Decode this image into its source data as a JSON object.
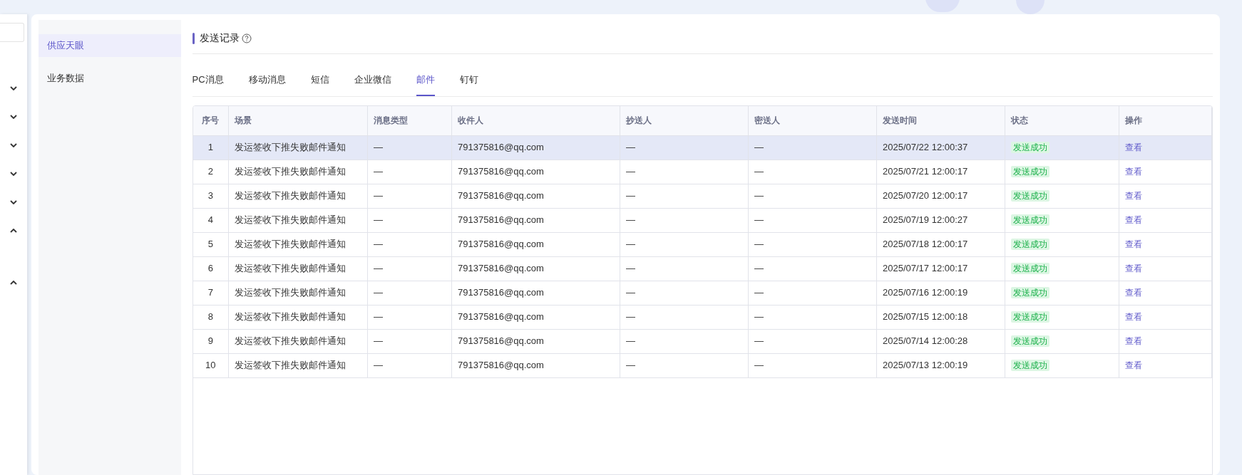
{
  "side_rail": {
    "chevrons": [
      {
        "expanded": false
      },
      {
        "expanded": false
      },
      {
        "expanded": false
      },
      {
        "expanded": false
      },
      {
        "expanded": false
      },
      {
        "expanded": true
      },
      {
        "expanded": true
      }
    ]
  },
  "sub_nav": {
    "items": [
      {
        "label": "供应天眼",
        "selected": true
      },
      {
        "label": "业务数据",
        "selected": false
      }
    ]
  },
  "section_title": "发送记录",
  "tabs": [
    {
      "label": "PC消息",
      "selected": false
    },
    {
      "label": "移动消息",
      "selected": false
    },
    {
      "label": "短信",
      "selected": false
    },
    {
      "label": "企业微信",
      "selected": false
    },
    {
      "label": "邮件",
      "selected": true
    },
    {
      "label": "钉钉",
      "selected": false
    }
  ],
  "table": {
    "columns": [
      "序号",
      "场景",
      "消息类型",
      "收件人",
      "抄送人",
      "密送人",
      "发送时间",
      "状态",
      "操作"
    ],
    "rows": [
      {
        "selected": true,
        "cells": [
          "1",
          "发运签收下推失败邮件通知",
          "—",
          "791375816@qq.com",
          "—",
          "—",
          "2025/07/22 12:00:37",
          "发送成功",
          "查看"
        ]
      },
      {
        "selected": false,
        "cells": [
          "2",
          "发运签收下推失败邮件通知",
          "—",
          "791375816@qq.com",
          "—",
          "—",
          "2025/07/21 12:00:17",
          "发送成功",
          "查看"
        ]
      },
      {
        "selected": false,
        "cells": [
          "3",
          "发运签收下推失败邮件通知",
          "—",
          "791375816@qq.com",
          "—",
          "—",
          "2025/07/20 12:00:17",
          "发送成功",
          "查看"
        ]
      },
      {
        "selected": false,
        "cells": [
          "4",
          "发运签收下推失败邮件通知",
          "—",
          "791375816@qq.com",
          "—",
          "—",
          "2025/07/19 12:00:27",
          "发送成功",
          "查看"
        ]
      },
      {
        "selected": false,
        "cells": [
          "5",
          "发运签收下推失败邮件通知",
          "—",
          "791375816@qq.com",
          "—",
          "—",
          "2025/07/18 12:00:17",
          "发送成功",
          "查看"
        ]
      },
      {
        "selected": false,
        "cells": [
          "6",
          "发运签收下推失败邮件通知",
          "—",
          "791375816@qq.com",
          "—",
          "—",
          "2025/07/17 12:00:17",
          "发送成功",
          "查看"
        ]
      },
      {
        "selected": false,
        "cells": [
          "7",
          "发运签收下推失败邮件通知",
          "—",
          "791375816@qq.com",
          "—",
          "—",
          "2025/07/16 12:00:19",
          "发送成功",
          "查看"
        ]
      },
      {
        "selected": false,
        "cells": [
          "8",
          "发运签收下推失败邮件通知",
          "—",
          "791375816@qq.com",
          "—",
          "—",
          "2025/07/15 12:00:18",
          "发送成功",
          "查看"
        ]
      },
      {
        "selected": false,
        "cells": [
          "9",
          "发运签收下推失败邮件通知",
          "—",
          "791375816@qq.com",
          "—",
          "—",
          "2025/07/14 12:00:28",
          "发送成功",
          "查看"
        ]
      },
      {
        "selected": false,
        "cells": [
          "10",
          "发运签收下推失败邮件通知",
          "—",
          "791375816@qq.com",
          "—",
          "—",
          "2025/07/13 12:00:19",
          "发送成功",
          "查看"
        ]
      }
    ]
  }
}
